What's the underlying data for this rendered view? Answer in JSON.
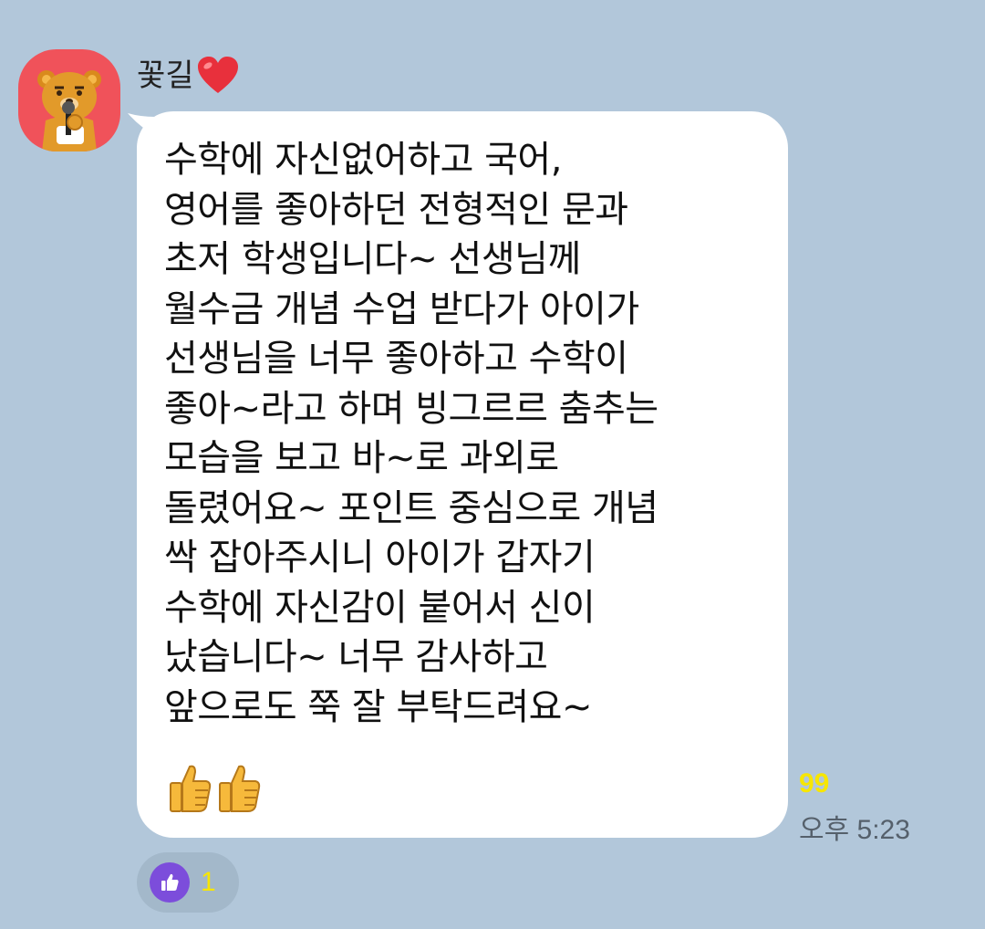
{
  "sender": {
    "name": "꽃길"
  },
  "message": {
    "text": "수학에 자신없어하고 국어,\n영어를 좋아하던 전형적인 문과\n초저 학생입니다~ 선생님께\n월수금 개념 수업 받다가 아이가\n선생님을 너무 좋아하고 수학이\n좋아~라고 하며 빙그르르 춤추는\n모습을 보고 바~로 과외로\n돌렸어요~ 포인트 중심으로 개념\n싹 잡아주시니 아이가 갑자기\n수학에 자신감이 붙어서 신이\n났습니다~ 너무 감사하고\n앞으로도 쭉 잘 부탁드려요~",
    "emoji": [
      "thumbs-up-icon",
      "thumbs-up-icon"
    ],
    "unread_count": "99",
    "time": "오후 5:23"
  },
  "reaction": {
    "icon": "thumbs-up-icon",
    "count": "1"
  },
  "colors": {
    "background": "#b2c7da",
    "bubble": "#ffffff",
    "unread": "#f7e600",
    "avatar": "#f0525a",
    "reaction_icon": "#7c4ddb"
  }
}
